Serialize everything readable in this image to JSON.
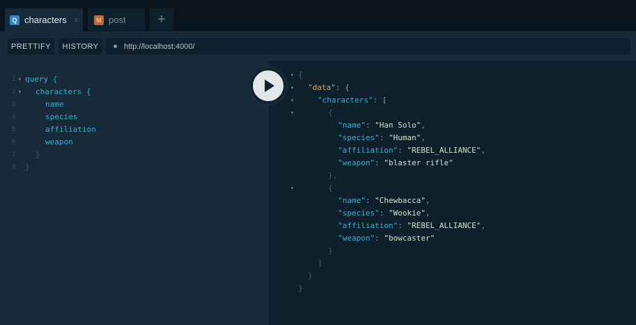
{
  "tabs": [
    {
      "badge": "Q",
      "label": "characters",
      "close": "×",
      "badge_color": "#2f87c7",
      "active": true
    },
    {
      "badge": "M",
      "label": "post",
      "badge_color": "#b86f3c",
      "active": false
    }
  ],
  "add_tab_glyph": "+",
  "toolbar": {
    "prettify": "PRETTIFY",
    "history": "HISTORY",
    "url": "http://localhost:4000/"
  },
  "query_lines": [
    {
      "num": "1",
      "text": "query {"
    },
    {
      "num": "2",
      "text": "characters {"
    },
    {
      "num": "3",
      "text": "name"
    },
    {
      "num": "4",
      "text": "species"
    },
    {
      "num": "5",
      "text": "affiliation"
    },
    {
      "num": "6",
      "text": "weapon"
    },
    {
      "num": "7",
      "text": "}"
    },
    {
      "num": "8",
      "text": "}"
    }
  ],
  "result": {
    "data_key": "\"data\"",
    "characters_key": "\"characters\"",
    "items": [
      {
        "name": "\"Han Solo\"",
        "species": "\"Human\"",
        "affiliation": "\"REBEL_ALLIANCE\"",
        "weapon": "\"blaster rifle\""
      },
      {
        "name": "\"Chewbacca\"",
        "species": "\"Wookie\"",
        "affiliation": "\"REBEL_ALLIANCE\"",
        "weapon": "\"bowcaster\""
      }
    ],
    "keys": {
      "name": "\"name\"",
      "species": "\"species\"",
      "affiliation": "\"affiliation\"",
      "weapon": "\"weapon\""
    }
  },
  "colors": {
    "accent": "#2bb3d7",
    "data_key": "#e0a85a",
    "string": "#c6e6c9",
    "background": "#0f202d",
    "editor": "#172a3a"
  },
  "icons": {
    "play": "play-icon",
    "fold": "fold-arrow-icon",
    "url_status": "status-dot-icon"
  }
}
